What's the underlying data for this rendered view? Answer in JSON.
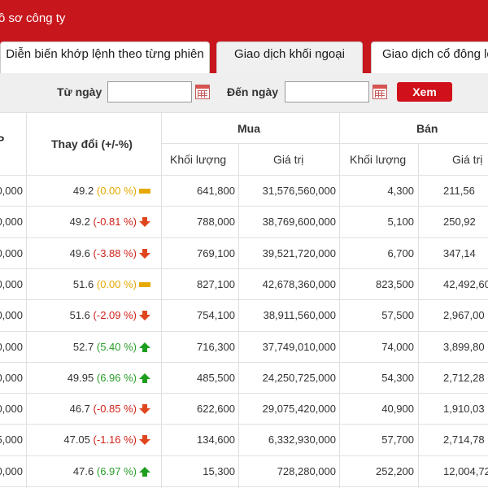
{
  "header": {
    "title": "ồ sơ công ty"
  },
  "tabs": [
    {
      "label": "Diễn biến khớp lệnh theo từng phiên"
    },
    {
      "label": "Giao dịch khối ngoại"
    },
    {
      "label": "Giao dịch cổ đông lớ"
    }
  ],
  "filter": {
    "from_label": "Từ ngày",
    "to_label": "Đến ngày",
    "from_value": "",
    "to_value": "",
    "button_label": "Xem"
  },
  "table": {
    "headers": {
      "price_partial": "P",
      "change": "Thay đổi (+/-%)",
      "buy": "Mua",
      "sell": "Bán",
      "volume": "Khối lượng",
      "value": "Giá trị"
    },
    "rows": [
      {
        "col0": "0,000",
        "price": "49.2",
        "pct": "(0.00 %)",
        "dir": "zero",
        "buy_vol": "641,800",
        "buy_val": "31,576,560,000",
        "sell_vol": "4,300",
        "sell_val": "211,56"
      },
      {
        "col0": "0,000",
        "price": "49.2",
        "pct": "(-0.81 %)",
        "dir": "down",
        "buy_vol": "788,000",
        "buy_val": "38,769,600,000",
        "sell_vol": "5,100",
        "sell_val": "250,92"
      },
      {
        "col0": "0,000",
        "price": "49.6",
        "pct": "(-3.88 %)",
        "dir": "down",
        "buy_vol": "769,100",
        "buy_val": "39,521,720,000",
        "sell_vol": "6,700",
        "sell_val": "347,14"
      },
      {
        "col0": "0,000",
        "price": "51.6",
        "pct": "(0.00 %)",
        "dir": "zero",
        "buy_vol": "827,100",
        "buy_val": "42,678,360,000",
        "sell_vol": "823,500",
        "sell_val": "42,492,60"
      },
      {
        "col0": "0,000",
        "price": "51.6",
        "pct": "(-2.09 %)",
        "dir": "down",
        "buy_vol": "754,100",
        "buy_val": "38,911,560,000",
        "sell_vol": "57,500",
        "sell_val": "2,967,00"
      },
      {
        "col0": "0,000",
        "price": "52.7",
        "pct": "(5.40 %)",
        "dir": "up",
        "buy_vol": "716,300",
        "buy_val": "37,749,010,000",
        "sell_vol": "74,000",
        "sell_val": "3,899,80"
      },
      {
        "col0": "0,000",
        "price": "49.95",
        "pct": "(6.96 %)",
        "dir": "up",
        "buy_vol": "485,500",
        "buy_val": "24,250,725,000",
        "sell_vol": "54,300",
        "sell_val": "2,712,28"
      },
      {
        "col0": "0,000",
        "price": "46.7",
        "pct": "(-0.85 %)",
        "dir": "down",
        "buy_vol": "622,600",
        "buy_val": "29,075,420,000",
        "sell_vol": "40,900",
        "sell_val": "1,910,03"
      },
      {
        "col0": "5,000",
        "price": "47.05",
        "pct": "(-1.16 %)",
        "dir": "down",
        "buy_vol": "134,600",
        "buy_val": "6,332,930,000",
        "sell_vol": "57,700",
        "sell_val": "2,714,78"
      },
      {
        "col0": "0,000",
        "price": "47.6",
        "pct": "(6.97 %)",
        "dir": "up",
        "buy_vol": "15,300",
        "buy_val": "728,280,000",
        "sell_vol": "252,200",
        "sell_val": "12,004,72"
      }
    ]
  },
  "colors": {
    "brand_red": "#c8161d",
    "up": "#2a9d2a",
    "down": "#d0231a",
    "zero": "#e5a900"
  }
}
